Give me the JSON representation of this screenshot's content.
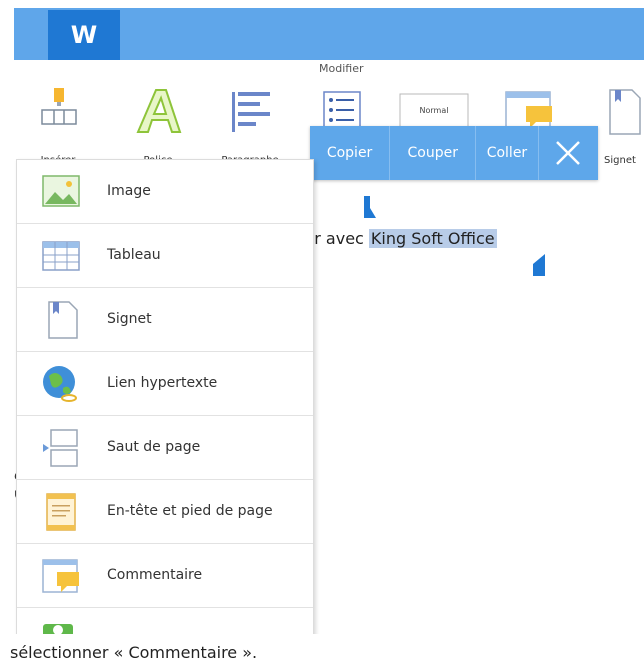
{
  "app": {
    "logo_text": "W"
  },
  "ribbon": {
    "group_label": "Modifier",
    "buttons": [
      {
        "label": "Insérer",
        "icon": "insert-icon"
      },
      {
        "label": "Police",
        "icon": "font-icon"
      },
      {
        "label": "Paragraphe",
        "icon": "paragraph-icon"
      },
      {
        "label": "",
        "icon": "list-icon"
      },
      {
        "label": "",
        "style_preview": "Normal",
        "icon": "style-icon"
      },
      {
        "label": "",
        "icon": "comment-icon"
      },
      {
        "label": "Signet",
        "icon": "bookmark-icon"
      }
    ]
  },
  "context_menu": {
    "items": [
      "Copier",
      "Couper",
      "Coller"
    ],
    "close_icon": "close-icon"
  },
  "document": {
    "text_before": "nter avec ",
    "selected_text": "King Soft Office"
  },
  "insert_menu": {
    "items": [
      {
        "label": "Image",
        "icon": "image-icon"
      },
      {
        "label": "Tableau",
        "icon": "table-icon"
      },
      {
        "label": "Signet",
        "icon": "bookmark-icon"
      },
      {
        "label": "Lien hypertexte",
        "icon": "hyperlink-icon"
      },
      {
        "label": "Saut de page",
        "icon": "page-break-icon"
      },
      {
        "label": "En-tête et pied de page",
        "icon": "header-footer-icon"
      },
      {
        "label": "Commentaire",
        "icon": "comment-icon"
      },
      {
        "label": "",
        "icon": "more-icon"
      }
    ]
  },
  "side_text": [
    "er",
    "u"
  ],
  "caption": "sélectionner « Commentaire »."
}
